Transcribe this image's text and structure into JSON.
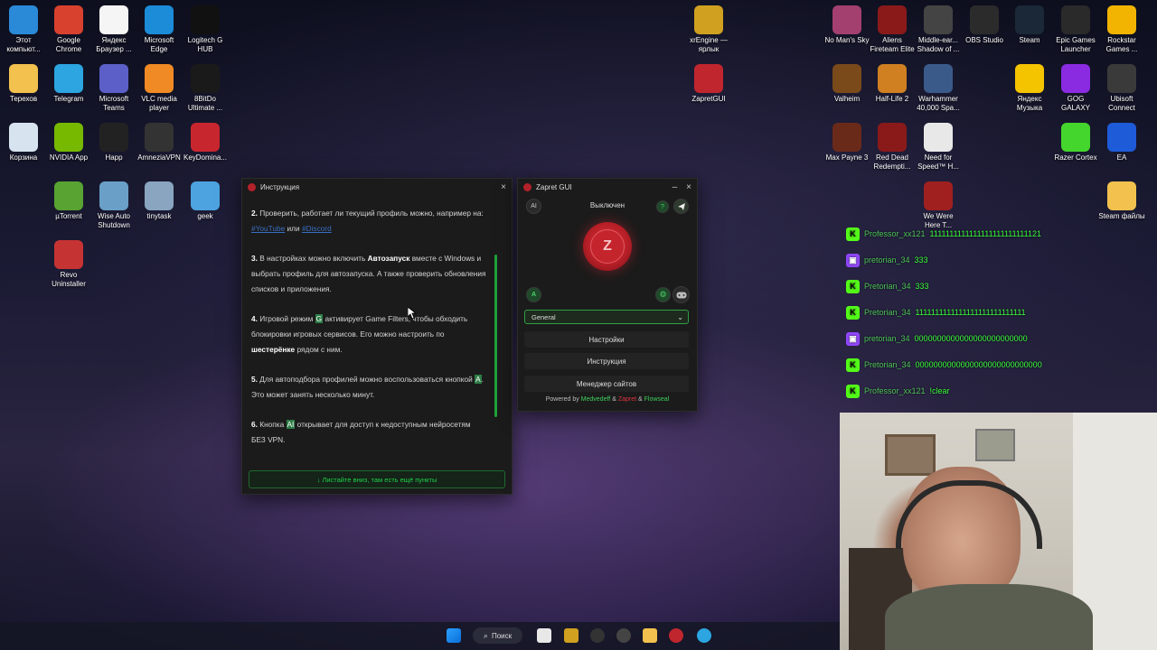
{
  "desktop_icons_left": [
    {
      "label": "Этот компьют...",
      "icon": "computer-icon",
      "color": "#2a8ad8"
    },
    {
      "label": "Google Chrome",
      "icon": "chrome-icon",
      "color": "#d9412f"
    },
    {
      "label": "Яндекс Браузер ...",
      "icon": "yandex-browser-icon",
      "color": "#f5f5f5"
    },
    {
      "label": "Microsoft Edge",
      "icon": "edge-icon",
      "color": "#1c8bd8"
    },
    {
      "label": "Logitech G HUB",
      "icon": "logitech-icon",
      "color": "#111111"
    },
    {
      "label": "Терехов",
      "icon": "folder-icon",
      "color": "#f2c14e"
    },
    {
      "label": "Telegram",
      "icon": "telegram-icon",
      "color": "#2ca5e0"
    },
    {
      "label": "Microsoft Teams",
      "icon": "teams-icon",
      "color": "#5b5fc7"
    },
    {
      "label": "VLC media player",
      "icon": "vlc-icon",
      "color": "#f08a24"
    },
    {
      "label": "8BitDo Ultimate ...",
      "icon": "8bitdo-icon",
      "color": "#1a1a1a"
    },
    {
      "label": "Корзина",
      "icon": "recycle-bin-icon",
      "color": "#d7e3ef"
    },
    {
      "label": "NVIDIA App",
      "icon": "nvidia-icon",
      "color": "#76b900"
    },
    {
      "label": "Happ",
      "icon": "happ-icon",
      "color": "#222222"
    },
    {
      "label": "AmneziaVPN",
      "icon": "amnezia-icon",
      "color": "#333333"
    },
    {
      "label": "KeyDomina...",
      "icon": "keydominator-icon",
      "color": "#c8262e"
    },
    {
      "label": "µTorrent",
      "icon": "utorrent-icon",
      "color": "#58a332"
    },
    {
      "label": "Wise Auto Shutdown",
      "icon": "wise-icon",
      "color": "#6aa0c7"
    },
    {
      "label": "tinytask",
      "icon": "tinytask-icon",
      "color": "#8aa5c0"
    },
    {
      "label": "geek",
      "icon": "geek-icon",
      "color": "#4da3e0"
    },
    {
      "label": "Revo Uninstaller",
      "icon": "revo-icon",
      "color": "#c63333"
    }
  ],
  "desktop_icons_mid": [
    {
      "label": "xrEngine — ярлык",
      "icon": "stalker-icon",
      "color": "#d0a020"
    },
    {
      "label": "ZapretGUI",
      "icon": "zapret-icon",
      "color": "#c0262e"
    }
  ],
  "desktop_icons_right": [
    {
      "label": "No Man's Sky",
      "icon": "nms-icon",
      "color": "#a34070"
    },
    {
      "label": "Aliens Fireteam Elite",
      "icon": "aliens-icon",
      "color": "#8a1a1a"
    },
    {
      "label": "Middle-ear... Shadow of ...",
      "icon": "middle-earth-icon",
      "color": "#444444"
    },
    {
      "label": "OBS Studio",
      "icon": "obs-icon",
      "color": "#2b2b2b"
    },
    {
      "label": "Steam",
      "icon": "steam-icon",
      "color": "#1b2838"
    },
    {
      "label": "Epic Games Launcher",
      "icon": "epic-icon",
      "color": "#2a2a2a"
    },
    {
      "label": "Rockstar Games ...",
      "icon": "rockstar-icon",
      "color": "#f2b400"
    },
    {
      "label": "Valheim",
      "icon": "valheim-icon",
      "color": "#7a4a1a"
    },
    {
      "label": "Half-Life 2",
      "icon": "hl2-icon",
      "color": "#d08020"
    },
    {
      "label": "Warhammer 40,000 Spa...",
      "icon": "warhammer-icon",
      "color": "#3a5a8a"
    },
    {
      "label": "Яндекс Музыка",
      "icon": "yandex-music-icon",
      "color": "#f5c400"
    },
    {
      "label": "GOG GALAXY",
      "icon": "gog-icon",
      "color": "#8a2be2"
    },
    {
      "label": "Ubisoft Connect",
      "icon": "ubisoft-icon",
      "color": "#3a3a3a"
    },
    {
      "label": "Max Payne 3",
      "icon": "max-payne-icon",
      "color": "#6a2a1a"
    },
    {
      "label": "Red Dead Redempti...",
      "icon": "rdr-icon",
      "color": "#8a1a1a"
    },
    {
      "label": "Need for Speed™ H...",
      "icon": "nfs-icon",
      "color": "#e8e8e8"
    },
    {
      "label": "Razer Cortex",
      "icon": "razer-icon",
      "color": "#44d62c"
    },
    {
      "label": "EA",
      "icon": "ea-icon",
      "color": "#1e5bd8"
    },
    {
      "label": "We Were Here T...",
      "icon": "we-were-here-icon",
      "color": "#a02020"
    },
    {
      "label": "Steam файлы",
      "icon": "folder-icon",
      "color": "#f2c14e"
    }
  ],
  "instruction_window": {
    "title": "Инструкция",
    "close": "×",
    "item2_num": "2.",
    "item2_text": "Проверить, работает ли текущий профиль можно, например на:",
    "item2_link1": "#YouTube",
    "item2_or": "или",
    "item2_link2": "#Discord",
    "item3_num": "3.",
    "item3_pre": "В настройках можно включить",
    "item3_bold": "Автозапуск",
    "item3_post": "вместе с Windows и выбрать профиль для автозапуска. А также проверить обновления списков и приложения.",
    "item4_num": "4.",
    "item4_pre": "Игровой режим",
    "item4_key": "G",
    "item4_mid": "активирует Game Filters, чтобы обходить блокировки игровых сервисов. Его можно настроить по",
    "item4_bold": "шестерёнке",
    "item4_post": "рядом с ним.",
    "item5_num": "5.",
    "item5_pre": "Для автоподбора профилей можно воспользоваться кнопкой",
    "item5_key": "A",
    "item5_post": ". Это может занять несколько минут.",
    "item6_num": "6.",
    "item6_pre": "Кнопка",
    "item6_key": "AI",
    "item6_post": "открывает для доступ к недоступным нейросетям БЕЗ VPN.",
    "scroll_hint": "↓ Листайте вниз, там есть ещё пункты"
  },
  "zapret_window": {
    "title": "Zapret GUI",
    "minimize": "–",
    "close": "×",
    "ai_label": "AI",
    "status": "Выключен",
    "help_label": "?",
    "power_letter": "Z",
    "auto_label": "A",
    "profile_selected": "General",
    "settings_button": "Настройки",
    "instruction_button": "Инструкция",
    "site_manager_button": "Менеджер сайтов",
    "powered_by": "Powered by",
    "credit1": "Medvedeff",
    "amp1": "&",
    "credit2": "Zapret",
    "amp2": "&",
    "credit3": "Flowseal"
  },
  "chat": [
    {
      "platform": "kick-icon",
      "name": "Professor_xx121",
      "msg": "1111111111111111111111111121"
    },
    {
      "platform": "twitch-icon",
      "name": "pretorian_34",
      "msg": "333"
    },
    {
      "platform": "kick-icon",
      "name": "Pretorian_34",
      "msg": "333"
    },
    {
      "platform": "kick-icon",
      "name": "Pretorian_34",
      "msg": "1111111111111111111111111111"
    },
    {
      "platform": "twitch-icon",
      "name": "pretorian_34",
      "msg": "0000000000000000000000000"
    },
    {
      "platform": "kick-icon",
      "name": "Pretorian_34",
      "msg": "0000000000000000000000000000"
    },
    {
      "platform": "kick-icon",
      "name": "Professor_xx121",
      "msg": "!clear"
    }
  ],
  "taskbar": {
    "search_label": "Поиск"
  }
}
